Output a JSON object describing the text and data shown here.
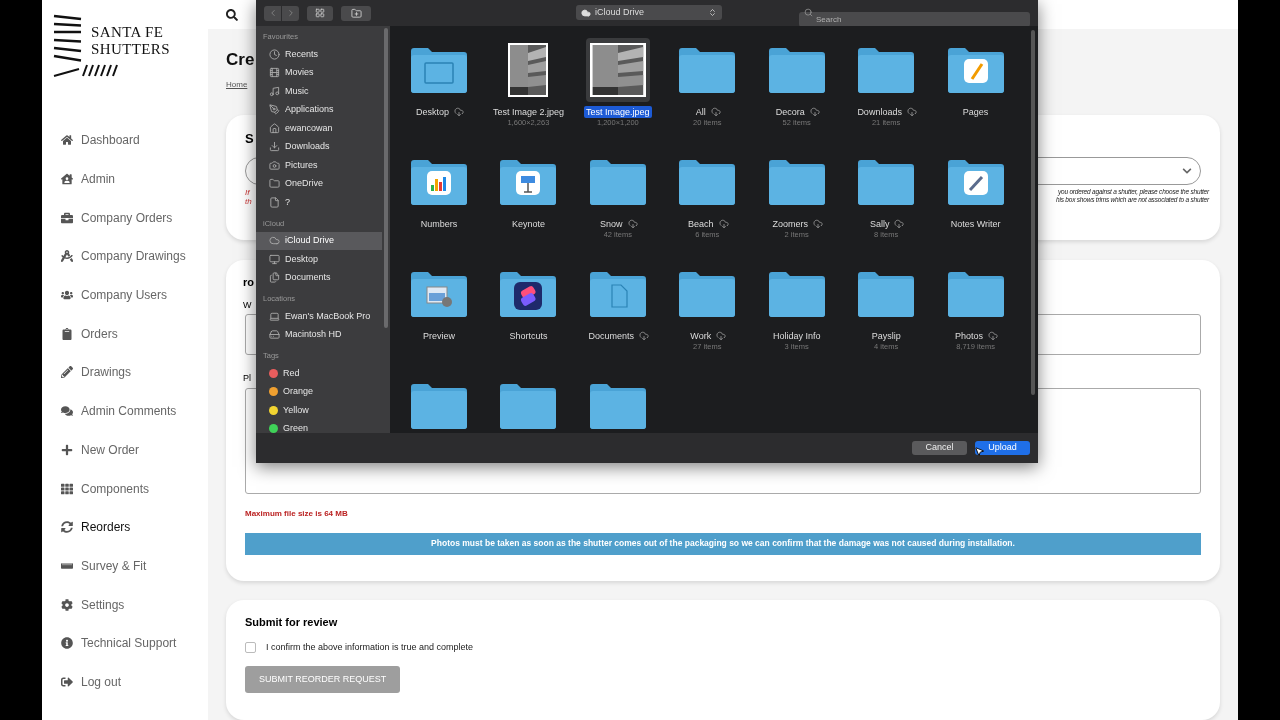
{
  "brand": {
    "line1": "SANTA FE",
    "line2": "SHUTTERS"
  },
  "nav": [
    {
      "label": "Dashboard",
      "selected": false
    },
    {
      "label": "Admin",
      "selected": false
    },
    {
      "label": "Company Orders",
      "selected": false
    },
    {
      "label": "Company Drawings",
      "selected": false
    },
    {
      "label": "Company Users",
      "selected": false
    },
    {
      "label": "Orders",
      "selected": false
    },
    {
      "label": "Drawings",
      "selected": false
    },
    {
      "label": "Admin Comments",
      "selected": false
    },
    {
      "label": "New Order",
      "selected": false
    },
    {
      "label": "Components",
      "selected": false
    },
    {
      "label": "Reorders",
      "selected": true
    },
    {
      "label": "Survey & Fit",
      "selected": false
    },
    {
      "label": "Settings",
      "selected": false
    },
    {
      "label": "Technical Support",
      "selected": false
    },
    {
      "label": "Log out",
      "selected": false
    }
  ],
  "page": {
    "title": "Cre",
    "breadcrumb": "Home"
  },
  "card1": {
    "heading": "S",
    "error_lines": [
      "If",
      "th"
    ],
    "help_lines": [
      "you ordered against a shutter, please choose the shutter",
      "his box shows trims which are not associated to a shutter"
    ]
  },
  "card2": {
    "heading": "ro",
    "field_label": "W",
    "photos_label": "Pl",
    "max_size": "Maximum file size is 64 MB",
    "banner": "Photos must be taken as soon as the shutter comes out of the packaging so we can confirm that the damage was not caused during installation."
  },
  "card3": {
    "heading": "Submit for review",
    "confirm": {
      "label": "I confirm the above information is true and complete",
      "checked": false
    },
    "submit": {
      "label": "SUBMIT REORDER REQUEST",
      "disabled": true
    }
  },
  "dialog": {
    "location": "iCloud Drive",
    "search_placeholder": "Search",
    "sidebar": [
      {
        "heading": "Favourites",
        "items": [
          {
            "label": "Recents",
            "selected": false
          },
          {
            "label": "Movies",
            "selected": false
          },
          {
            "label": "Music",
            "selected": false
          },
          {
            "label": "Applications",
            "selected": false
          },
          {
            "label": "ewancowan",
            "selected": false
          },
          {
            "label": "Downloads",
            "selected": false
          },
          {
            "label": "Pictures",
            "selected": false
          },
          {
            "label": "OneDrive",
            "selected": false
          },
          {
            "label": "?",
            "selected": false
          }
        ]
      },
      {
        "heading": "iCloud",
        "items": [
          {
            "label": "iCloud Drive",
            "selected": true
          },
          {
            "label": "Desktop",
            "selected": false
          },
          {
            "label": "Documents",
            "selected": false
          }
        ]
      },
      {
        "heading": "Locations",
        "items": [
          {
            "label": "Ewan's MacBook Pro",
            "selected": false
          },
          {
            "label": "Macintosh HD",
            "selected": false
          }
        ]
      },
      {
        "heading": "Tags",
        "items": [
          {
            "label": "Red",
            "selected": false,
            "color": "#e85d5d"
          },
          {
            "label": "Orange",
            "selected": false,
            "color": "#f0a030"
          },
          {
            "label": "Yellow",
            "selected": false,
            "color": "#f2d431"
          },
          {
            "label": "Green",
            "selected": false,
            "color": "#3fd158"
          }
        ]
      }
    ],
    "files": [
      {
        "kind": "folder",
        "name": "Desktop",
        "cloud": true,
        "selected": false
      },
      {
        "name": "Test Image 2.jpeg",
        "sub": "1,600×2,263",
        "cloud": false,
        "selected": false
      },
      {
        "name": "Test Image.jpeg",
        "sub": "1,200×1,200",
        "cloud": false,
        "selected": true
      },
      {
        "kind": "folder",
        "name": "All",
        "sub": "20 items",
        "cloud": true,
        "selected": false
      },
      {
        "kind": "folder",
        "name": "Decora",
        "sub": "52 items",
        "cloud": true,
        "selected": false
      },
      {
        "kind": "folder",
        "name": "Downloads",
        "sub": "21 items",
        "cloud": true,
        "selected": false
      },
      {
        "kind": "folder",
        "name": "Pages",
        "cloud": false,
        "selected": false
      },
      {
        "kind": "folder",
        "name": "Numbers",
        "cloud": false,
        "selected": false
      },
      {
        "kind": "folder",
        "name": "Keynote",
        "cloud": false,
        "selected": false
      },
      {
        "kind": "folder",
        "name": "Snow",
        "sub": "42 items",
        "cloud": true,
        "selected": false
      },
      {
        "kind": "folder",
        "name": "Beach",
        "sub": "6 items",
        "cloud": true,
        "selected": false
      },
      {
        "kind": "folder",
        "name": "Zoomers",
        "sub": "2 items",
        "cloud": true,
        "selected": false
      },
      {
        "kind": "folder",
        "name": "Sally",
        "sub": "8 items",
        "cloud": true,
        "selected": false
      },
      {
        "kind": "folder",
        "name": "Notes Writer",
        "cloud": false,
        "selected": false
      },
      {
        "kind": "folder",
        "name": "Preview",
        "cloud": false,
        "selected": false
      },
      {
        "kind": "folder",
        "name": "Shortcuts",
        "cloud": false,
        "selected": false
      },
      {
        "kind": "folder",
        "name": "Documents",
        "cloud": true,
        "selected": false
      },
      {
        "kind": "folder",
        "name": "Work",
        "sub": "27 items",
        "cloud": true,
        "selected": false
      },
      {
        "kind": "folder",
        "name": "Holiday Info",
        "sub": "3 items",
        "cloud": false,
        "selected": false
      },
      {
        "kind": "folder",
        "name": "Payslip",
        "sub": "4 items",
        "cloud": false,
        "selected": false
      },
      {
        "kind": "folder",
        "name": "Photos",
        "sub": "8,719 items",
        "cloud": true,
        "selected": false
      },
      {
        "kind": "folder",
        "cloud": false,
        "selected": false
      },
      {
        "kind": "folder",
        "cloud": false,
        "selected": false
      },
      {
        "kind": "folder",
        "cloud": false,
        "selected": false
      }
    ],
    "cancel": "Cancel",
    "upload": "Upload"
  }
}
